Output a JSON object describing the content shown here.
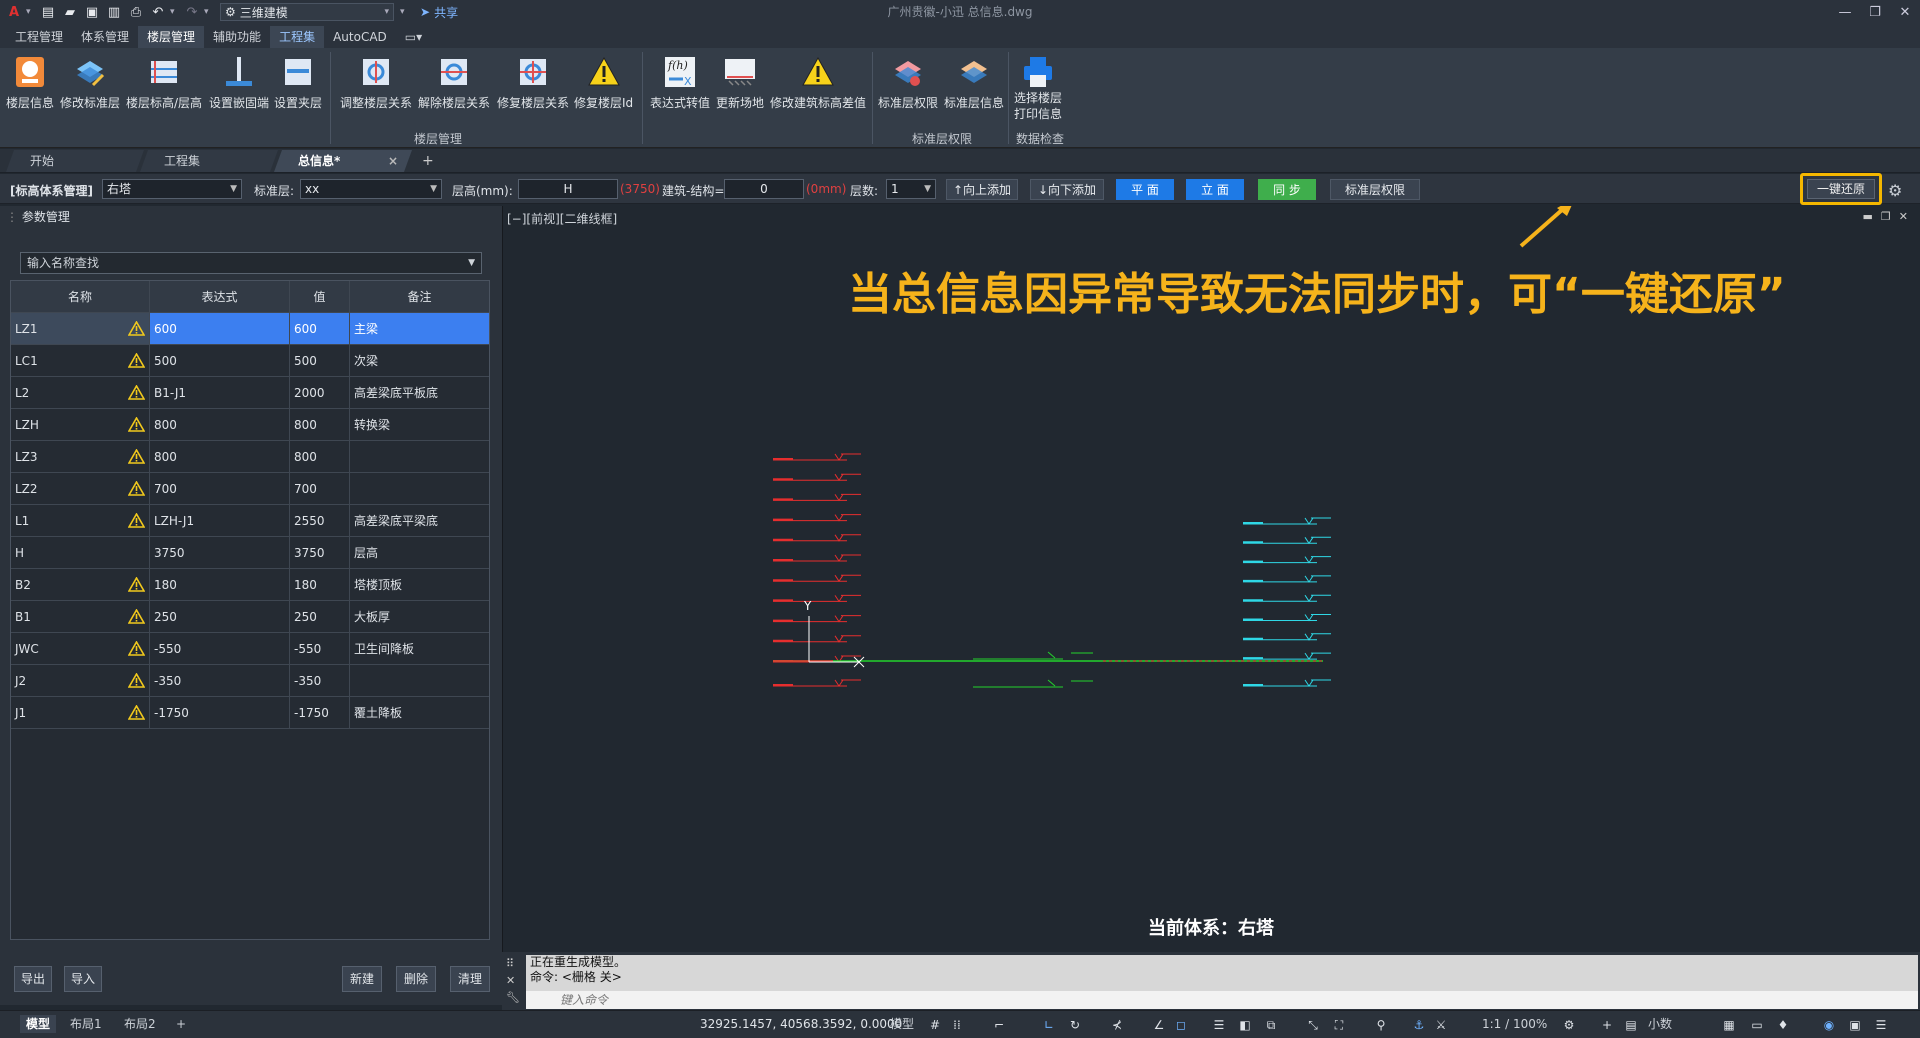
{
  "titlebar": {
    "workspace": "三维建模",
    "share": "共享",
    "window_title": "广州贵徽-小迅    总信息.dwg"
  },
  "menubar": {
    "tabs": [
      "工程管理",
      "体系管理",
      "楼层管理",
      "辅助功能",
      "工程集",
      "AutoCAD"
    ]
  },
  "ribbon": {
    "buttons": [
      "楼层信息",
      "修改标准层",
      "楼层标高/层高",
      "设置嵌固端",
      "设置夹层",
      "调整楼层关系",
      "解除楼层关系",
      "修复楼层关系",
      "修复楼层Id",
      "表达式转值",
      "更新场地",
      "修改建筑标高差值",
      "标准层权限",
      "标准层信息",
      "选择楼层\n打印信息"
    ],
    "groups": [
      "楼层管理",
      "标准层权限",
      "数据检查"
    ]
  },
  "doctabs": {
    "tabs": [
      "开始",
      "工程集",
      "总信息*"
    ],
    "close": "×",
    "add": "+"
  },
  "paramsbar": {
    "system_label": "[标高体系管理]",
    "system_value": "右塔",
    "std_label": "标准层:",
    "std_value": "xx",
    "height_label": "层高(mm):",
    "height_value": "H",
    "height_hint": "(3750)",
    "diff_label": "建筑-结构=",
    "diff_value": "0",
    "diff_hint": "(0mm)",
    "floors_label": "层数:",
    "floors_value": "1",
    "btn_up": "↑向上添加",
    "btn_down": "↓向下添加",
    "btn_plan": "平  面",
    "btn_elev": "立  面",
    "btn_sync": "同  步",
    "btn_perm": "标准层权限",
    "btn_restore": "一键还原"
  },
  "leftpanel": {
    "title": "参数管理",
    "search_placeholder": "输入名称查找",
    "columns": [
      "名称",
      "表达式",
      "值",
      "备注"
    ],
    "rows": [
      {
        "name": "LZ1",
        "expr": "600",
        "value": "600",
        "note": "主梁",
        "warn": true,
        "selected": true
      },
      {
        "name": "LC1",
        "expr": "500",
        "value": "500",
        "note": "次梁",
        "warn": true
      },
      {
        "name": "L2",
        "expr": "B1-J1",
        "value": "2000",
        "note": "高差梁底平板底",
        "warn": true
      },
      {
        "name": "LZH",
        "expr": "800",
        "value": "800",
        "note": "转换梁",
        "warn": true
      },
      {
        "name": "LZ3",
        "expr": "800",
        "value": "800",
        "note": "",
        "warn": true
      },
      {
        "name": "LZ2",
        "expr": "700",
        "value": "700",
        "note": "",
        "warn": true
      },
      {
        "name": "L1",
        "expr": "LZH-J1",
        "value": "2550",
        "note": "高差梁底平梁底",
        "warn": true
      },
      {
        "name": "H",
        "expr": "3750",
        "value": "3750",
        "note": "层高",
        "warn": false
      },
      {
        "name": "B2",
        "expr": "180",
        "value": "180",
        "note": "塔楼顶板",
        "warn": true
      },
      {
        "name": "B1",
        "expr": "250",
        "value": "250",
        "note": "大板厚",
        "warn": true
      },
      {
        "name": "JWC",
        "expr": "-550",
        "value": "-550",
        "note": "卫生间降板",
        "warn": true
      },
      {
        "name": "J2",
        "expr": "-350",
        "value": "-350",
        "note": "",
        "warn": true
      },
      {
        "name": "J1",
        "expr": "-1750",
        "value": "-1750",
        "note": "覆土降板",
        "warn": true
      }
    ],
    "btn_export": "导出",
    "btn_import": "导入",
    "btn_new": "新建",
    "btn_delete": "删除",
    "btn_clear": "清理"
  },
  "canvas": {
    "view_label": "[−][前视][二维线框]",
    "annotation": "当总信息因异常导致无法同步时，可“一键还原”",
    "current_system": "当前体系：右塔",
    "axis_y": "Y"
  },
  "command": {
    "line1": "正在重生成模型。",
    "line2": "命令:  <栅格 关>",
    "placeholder": "键入命令"
  },
  "statusbar": {
    "tabs": [
      "模型",
      "布局1",
      "布局2"
    ],
    "add": "+",
    "coords": "32925.1457, 40568.3592, 0.0000",
    "mode": "模型",
    "scale": "1:1 / 100%",
    "units": "小数"
  },
  "colors": {
    "accent": "#f6b31b",
    "blue": "#1e7ae6",
    "green": "#3fae4c",
    "selected": "#3c7ff0"
  }
}
